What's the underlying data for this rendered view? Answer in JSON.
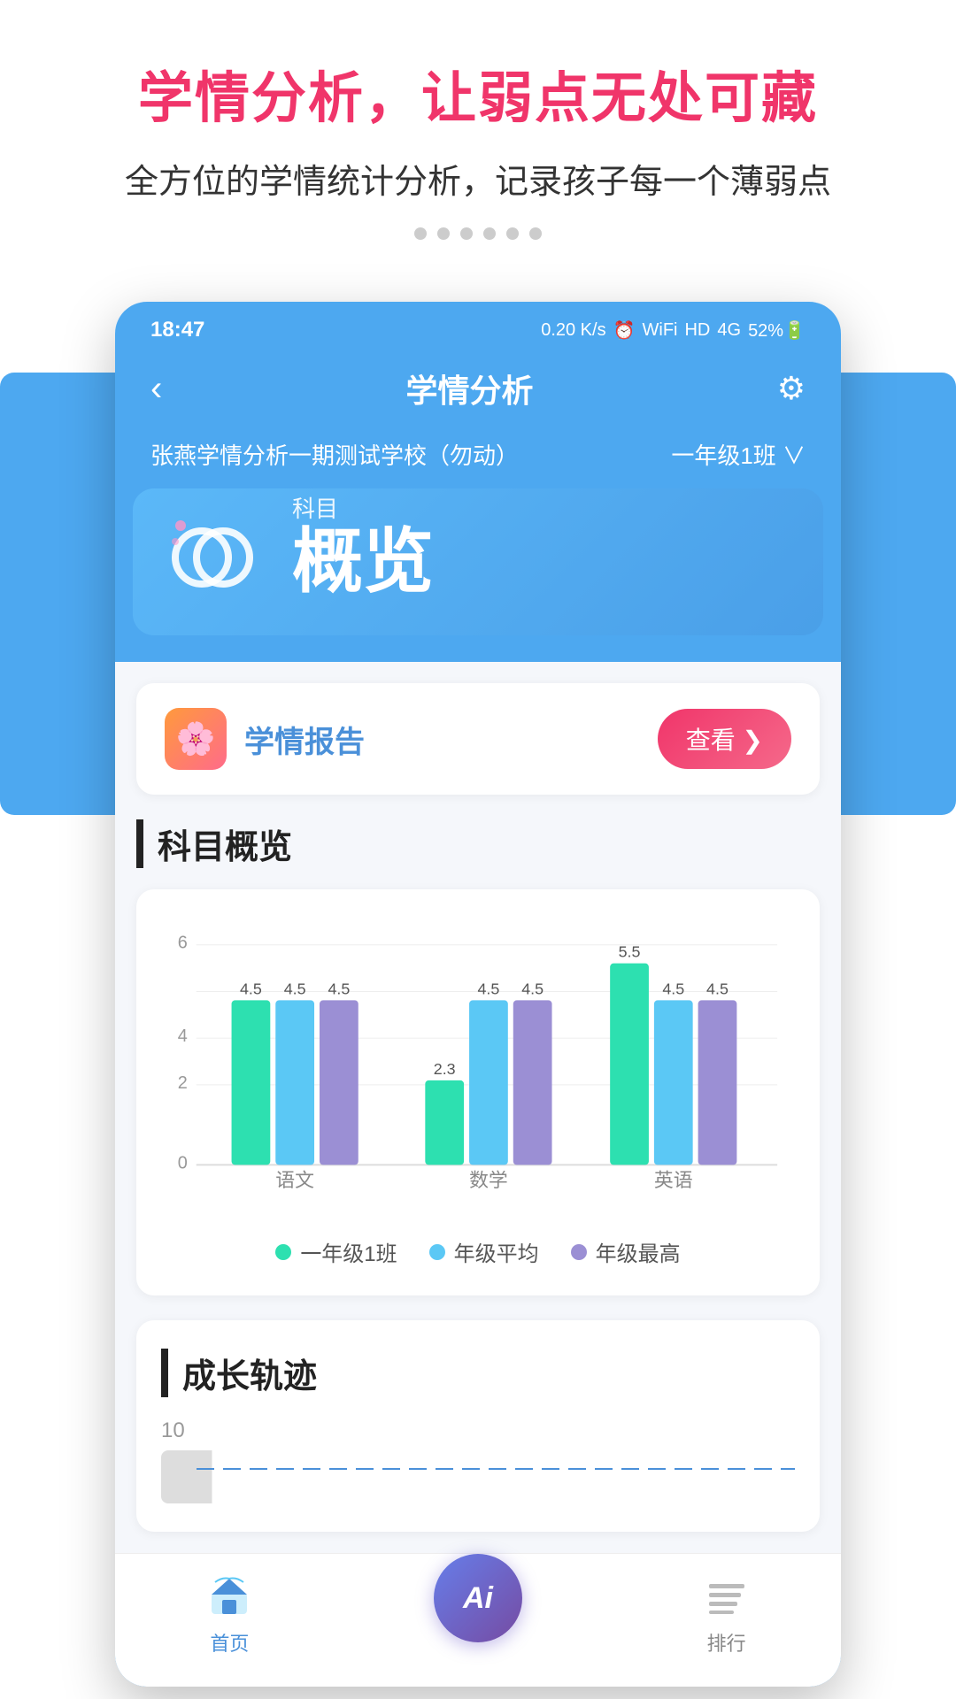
{
  "marketing": {
    "title": "学情分析，让弱点无处可藏",
    "subtitle": "全方位的学情统计分析，记录孩子每一个薄弱点"
  },
  "statusBar": {
    "time": "18:47",
    "icons": "0.20 K/s ⏰ WiFi HD 4G HD 4G 52%"
  },
  "navBar": {
    "back": "‹",
    "title": "学情分析",
    "gear": "⚙"
  },
  "schoolBar": {
    "schoolName": "张燕学情分析一期测试学校（勿动）",
    "classSelector": "一年级1班 ∨"
  },
  "tab": {
    "labelSmall": "科目",
    "labelLarge": "概览"
  },
  "reportCard": {
    "title": "学情报告",
    "viewBtn": "查看 ❯"
  },
  "subjectOverview": {
    "sectionTitle": "科目概览",
    "yAxisMax": "6",
    "yAxisLabels": [
      "6",
      "4",
      "2",
      "0"
    ],
    "subjects": [
      "语文",
      "数学",
      "英语"
    ],
    "bars": {
      "yuwen": {
        "class1": 4.5,
        "avg": 4.5,
        "max": 4.5
      },
      "shuxue": {
        "class1": 2.3,
        "avg": 4.5,
        "max": 4.5
      },
      "yingyu": {
        "class1": 5.5,
        "avg": 4.5,
        "max": 4.5
      }
    },
    "legend": {
      "class1": "一年级1班",
      "avg": "年级平均",
      "max": "年级最高"
    },
    "colors": {
      "class1": "#2de0b0",
      "avg": "#5bc8f5",
      "max": "#9b8fd4"
    }
  },
  "growthSection": {
    "sectionTitle": "成长轨迹",
    "yAxisMax": "10"
  },
  "bottomNav": {
    "home": "首页",
    "rank": "排行",
    "ai": "Ai"
  },
  "dots": [
    "•",
    "•",
    "•",
    "•",
    "•",
    "•"
  ]
}
